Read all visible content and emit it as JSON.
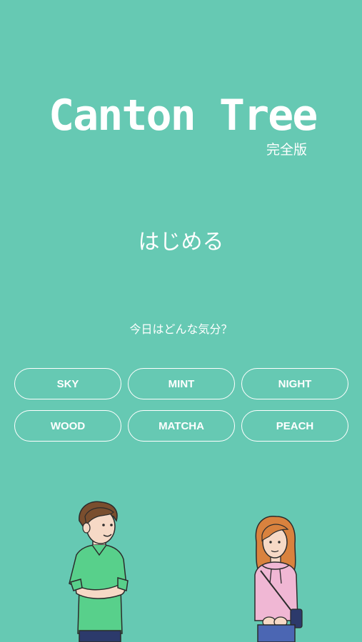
{
  "title": "Canton Tree",
  "edition": "完全版",
  "start_label": "はじめる",
  "mood_question": "今日はどんな気分？",
  "themes": [
    "SKY",
    "MINT",
    "NIGHT",
    "WOOD",
    "MATCHA",
    "PEACH"
  ],
  "colors": {
    "background": "#66c9b3",
    "text": "#ffffff"
  }
}
